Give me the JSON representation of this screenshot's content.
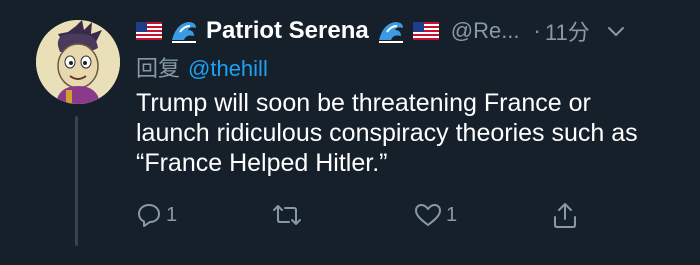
{
  "tweet": {
    "author": {
      "display_name": "Patriot Serena",
      "handle": "@Re...",
      "name_decorations": [
        "us-flag",
        "wave",
        "wave",
        "us-flag"
      ]
    },
    "time_separator": "·",
    "time": "11分",
    "reply_prefix": "回复",
    "reply_to": "@thehill",
    "text": "Trump will soon be threatening France or\nlaunch ridiculous conspiracy theories such as\n“France Helped Hitler.”",
    "actions": {
      "reply_count": "1",
      "retweet_count": "",
      "like_count": "1"
    }
  },
  "icons": {
    "more": "chevron-down-icon",
    "reply": "comment-icon",
    "retweet": "retweet-icon",
    "like": "heart-icon",
    "share": "share-icon"
  },
  "colors": {
    "background": "#15202b",
    "primary_text": "#ffffff",
    "secondary_text": "#8899a6",
    "mention": "#1da1f2",
    "thread_line": "#38444d"
  }
}
